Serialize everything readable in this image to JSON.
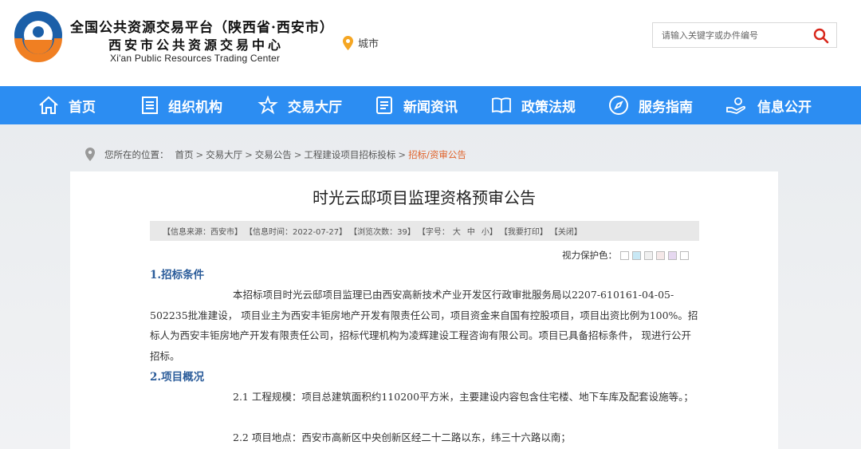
{
  "header": {
    "title_line1": "全国公共资源交易平台（陕西省·西安市）",
    "title_line2": "西安市公共资源交易中心",
    "title_en": "Xi'an Public Resources Trading Center",
    "city_label": "城市",
    "search_placeholder": "请输入关键字或办件编号"
  },
  "nav": {
    "items": [
      {
        "label": "首页",
        "icon": "home-icon"
      },
      {
        "label": "组织机构",
        "icon": "document-icon"
      },
      {
        "label": "交易大厅",
        "icon": "star-icon"
      },
      {
        "label": "新闻资讯",
        "icon": "news-icon"
      },
      {
        "label": "政策法规",
        "icon": "book-icon"
      },
      {
        "label": "服务指南",
        "icon": "compass-icon"
      },
      {
        "label": "信息公开",
        "icon": "hand-icon"
      }
    ]
  },
  "breadcrumb": {
    "label": "您所在的位置：",
    "items": [
      "首页",
      "交易大厅",
      "交易公告",
      "工程建设项目招标投标"
    ],
    "current": "招标/资审公告"
  },
  "article": {
    "title": "时光云邸项目监理资格预审公告",
    "meta": {
      "source": "【信息来源：西安市】",
      "time": "【信息时间：2022-07-27】",
      "views": "【浏览次数：39】",
      "font_label": "【字号：",
      "font_large": "大",
      "font_medium": "中",
      "font_small": "小",
      "font_end": "】",
      "print": "【我要打印】",
      "close": "【关闭】"
    },
    "eye_protect_label": "视力保护色：",
    "eye_colors": [
      "#ffffff",
      "#c8e8f5",
      "#f0f0f0",
      "#f5e8e8",
      "#e6d8f0",
      "#ffffff"
    ],
    "section1_heading": "1.招标条件",
    "section1_body": "本招标项目时光云邸项目监理已由西安高新技术产业开发区行政审批服务局以2207-610161-04-05-502235批准建设， 项目业主为西安丰钜房地产开发有限责任公司，项目资金来自国有控股项目，项目出资比例为100%。招标人为西安丰钜房地产开发有限责任公司，招标代理机构为凌辉建设工程咨询有限公司。项目已具备招标条件， 现进行公开招标。",
    "section2_heading": "2.项目概况",
    "section2_item1": "2.1 工程规模：项目总建筑面积约110200平方米，主要建设内容包含住宅楼、地下车库及配套设施等。；",
    "section2_item2": "2.2 项目地点：西安市高新区中央创新区经二十二路以东，纬三十六路以南；"
  },
  "colors": {
    "nav_bg": "#2c8df2",
    "accent_orange": "#e0622a",
    "heading_blue": "#2b5c9a"
  }
}
